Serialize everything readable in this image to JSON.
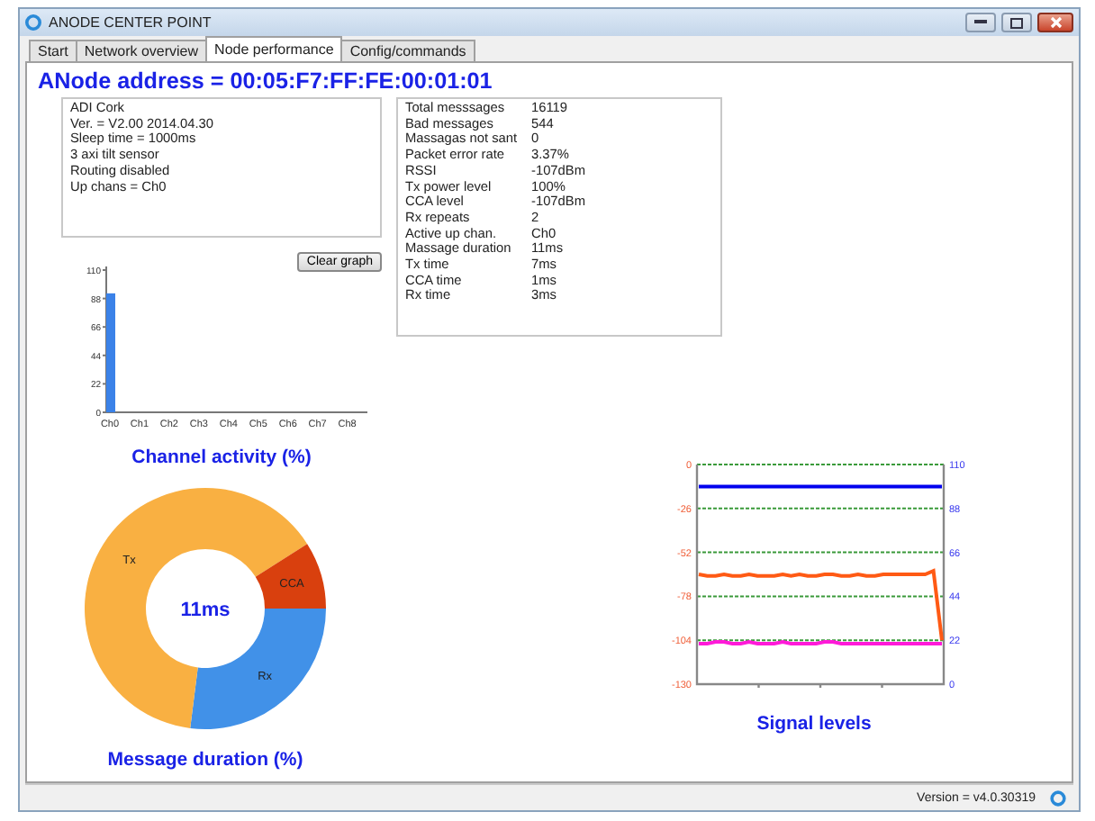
{
  "window": {
    "title": "ANODE CENTER POINT"
  },
  "tabs": [
    {
      "label": "Start",
      "selected": false
    },
    {
      "label": "Network overview",
      "selected": false
    },
    {
      "label": "Node performance",
      "selected": true
    },
    {
      "label": "Config/commands",
      "selected": false
    }
  ],
  "address": "ANode address = 00:05:F7:FF:FE:00:01:01",
  "node_info": [
    "ADI Cork",
    "Ver. = V2.00 2014.04.30",
    "Sleep time = 1000ms",
    "3 axi tilt sensor",
    "Routing disabled",
    "Up chans = Ch0"
  ],
  "statistics": [
    {
      "label": "Total messsages",
      "value": "16119"
    },
    {
      "label": "Bad messages",
      "value": "544"
    },
    {
      "label": "Massagas not sant",
      "value": "0"
    },
    {
      "label": "Packet error rate",
      "value": "3.37%"
    },
    {
      "label": "RSSI",
      "value": "-107dBm"
    },
    {
      "label": "Tx power level",
      "value": "100%"
    },
    {
      "label": "CCA level",
      "value": "-107dBm"
    },
    {
      "label": "Rx repeats",
      "value": "2"
    },
    {
      "label": "Active up chan.",
      "value": "Ch0"
    },
    {
      "label": "Massage duration",
      "value": "11ms"
    },
    {
      "label": "Tx time",
      "value": "7ms"
    },
    {
      "label": "CCA time",
      "value": "1ms"
    },
    {
      "label": "Rx time",
      "value": "3ms"
    }
  ],
  "channel_activity": {
    "button": "Clear graph",
    "title": "Channel activity (%)",
    "chart_data": {
      "type": "bar",
      "categories": [
        "Ch0",
        "Ch1",
        "Ch2",
        "Ch3",
        "Ch4",
        "Ch5",
        "Ch6",
        "Ch7",
        "Ch8"
      ],
      "series": [
        {
          "color": "#3b82e8",
          "values": [
            92,
            0,
            0,
            0,
            0,
            0,
            0,
            0,
            0
          ]
        }
      ],
      "ylim": [
        0,
        110
      ],
      "yticks": [
        0,
        22,
        44,
        66,
        88,
        110
      ]
    }
  },
  "message_duration": {
    "title": "Message duration (%)",
    "chart_data": {
      "type": "donut",
      "categories": [
        "Rx",
        "Tx",
        "CCA"
      ],
      "values": [
        27,
        64,
        9
      ],
      "colors": [
        "#4191e8",
        "#f9b042",
        "#d9400e"
      ],
      "annotations": [
        "11ms"
      ]
    }
  },
  "signal_levels": {
    "title": "Signal levels",
    "chart_data": {
      "type": "line",
      "ylim": [
        -130,
        0
      ],
      "yticks": [
        -130,
        -104,
        -78,
        -52,
        -26,
        0
      ],
      "grid": true,
      "y2lim": [
        0,
        110
      ],
      "y2ticks": [
        0,
        22,
        44,
        66,
        88,
        110
      ],
      "series": [
        {
          "color": "#0000ee",
          "axis": "y2",
          "values": [
            99,
            99,
            99,
            99,
            99,
            99,
            99,
            99,
            99,
            99,
            99,
            99,
            99,
            99,
            99,
            99,
            99,
            99,
            99,
            99,
            99,
            99,
            99,
            99,
            99,
            99,
            99,
            99,
            99,
            99
          ]
        },
        {
          "color": "#ff5a14",
          "values": [
            -65,
            -66,
            -66,
            -65,
            -66,
            -66,
            -65,
            -66,
            -66,
            -66,
            -65,
            -66,
            -65,
            -66,
            -66,
            -65,
            -65,
            -66,
            -66,
            -65,
            -66,
            -66,
            -65,
            -65,
            -65,
            -65,
            -65,
            -65,
            -63,
            -104
          ]
        },
        {
          "color": "#ff1ad9",
          "values": [
            -106,
            -106,
            -105,
            -105,
            -106,
            -106,
            -105,
            -106,
            -106,
            -106,
            -105,
            -106,
            -106,
            -106,
            -106,
            -105,
            -105,
            -106,
            -106,
            -106,
            -106,
            -106,
            -106,
            -106,
            -106,
            -106,
            -106,
            -106,
            -106,
            -106
          ]
        }
      ]
    }
  },
  "status_bar": {
    "version": "Version = v4.0.30319"
  }
}
